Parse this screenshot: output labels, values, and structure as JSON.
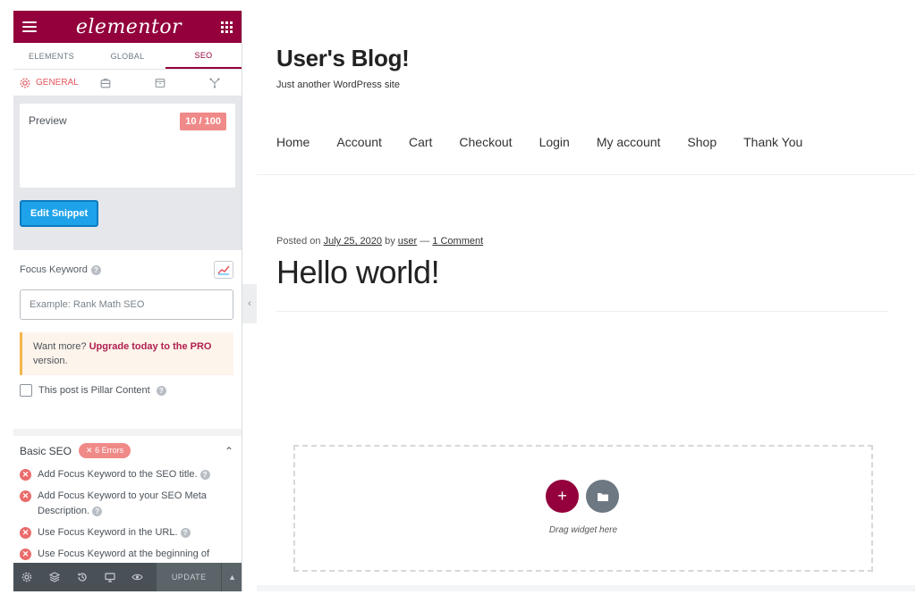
{
  "panel": {
    "logo": "elementor",
    "tabs": [
      {
        "label": "ELEMENTS"
      },
      {
        "label": "GLOBAL"
      },
      {
        "label": "SEO"
      }
    ],
    "subtabs": {
      "general_label": "GENERAL"
    },
    "preview": {
      "label": "Preview",
      "score": "10 / 100",
      "edit_snippet_label": "Edit Snippet"
    },
    "focus_keyword": {
      "label": "Focus Keyword",
      "placeholder": "Example: Rank Math SEO",
      "value": ""
    },
    "upgrade": {
      "text_before": "Want more? ",
      "link": "Upgrade today to the PRO",
      "text_after": " version."
    },
    "pillar": {
      "label": "This post is Pillar Content",
      "checked": false
    },
    "basic_seo": {
      "title": "Basic SEO",
      "errors_badge": "✕ 6 Errors",
      "items": [
        {
          "text": "Add Focus Keyword to the SEO title."
        },
        {
          "text": "Add Focus Keyword to your SEO Meta Description."
        },
        {
          "text": "Use Focus Keyword in the URL."
        },
        {
          "text": "Use Focus Keyword at the beginning of"
        }
      ]
    },
    "footer": {
      "update_label": "UPDATE"
    }
  },
  "site": {
    "title": "User's Blog!",
    "tagline": "Just another WordPress site",
    "nav": [
      {
        "label": "Home"
      },
      {
        "label": "Account"
      },
      {
        "label": "Cart"
      },
      {
        "label": "Checkout"
      },
      {
        "label": "Login"
      },
      {
        "label": "My account"
      },
      {
        "label": "Shop"
      },
      {
        "label": "Thank You"
      }
    ],
    "post": {
      "meta_posted_on": "Posted on ",
      "date": "July 25, 2020",
      "meta_by": " by ",
      "author": "user",
      "meta_sep": " — ",
      "comments": "1 Comment",
      "title": "Hello world!"
    },
    "drop_zone": {
      "text": "Drag widget here"
    }
  },
  "colors": {
    "brand": "#93003c",
    "accent_blue": "#1ea3ea",
    "error_red": "#eb6b6b",
    "panel_dark": "#495157"
  }
}
